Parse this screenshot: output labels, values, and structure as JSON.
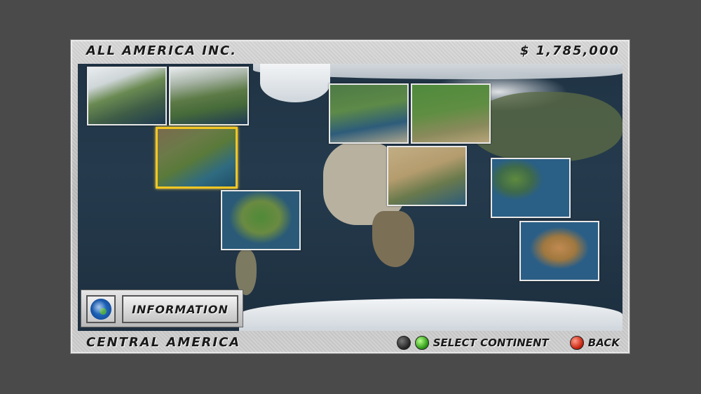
{
  "header": {
    "company_name": "ALL AMERICA INC.",
    "money": "$ 1,785,000"
  },
  "map": {
    "regions": [
      {
        "id": "alaska",
        "selected": false
      },
      {
        "id": "canada",
        "selected": false
      },
      {
        "id": "central-america",
        "selected": true
      },
      {
        "id": "south-america",
        "selected": false
      },
      {
        "id": "europe",
        "selected": false
      },
      {
        "id": "russia",
        "selected": false
      },
      {
        "id": "middle-east-africa",
        "selected": false
      },
      {
        "id": "southeast-asia",
        "selected": false
      },
      {
        "id": "australia",
        "selected": false
      }
    ]
  },
  "info_panel": {
    "globe_icon": "globe-icon",
    "button_label": "INFORMATION"
  },
  "footer": {
    "selected_region": "CENTRAL AMERICA",
    "select_hint": "SELECT CONTINENT",
    "back_hint": "BACK"
  },
  "colors": {
    "selection_border": "#f3c623",
    "tile_border": "#e8e8e8",
    "background": "#4a4a4a"
  }
}
